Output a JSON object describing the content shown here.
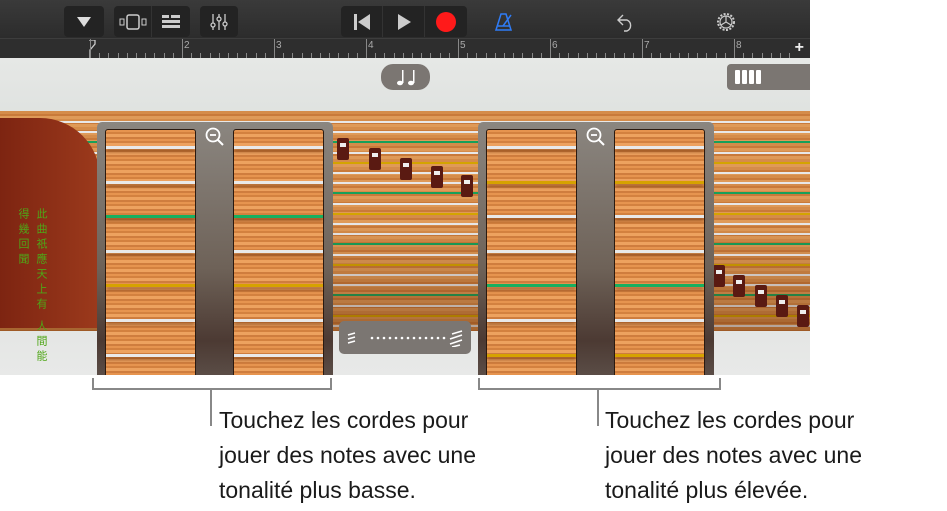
{
  "toolbar": {
    "icons": [
      "dropdown-icon",
      "view-toggle-icon",
      "tracks-view-icon",
      "mixer-icon",
      "rewind-icon",
      "play-icon",
      "record-icon",
      "metronome-icon",
      "undo-icon",
      "settings-icon"
    ],
    "colors": {
      "record": "#ff1a1a",
      "metronome": "#2f7cf6"
    }
  },
  "ruler": {
    "bars": [
      "2",
      "3",
      "4",
      "5",
      "6",
      "7",
      "8"
    ],
    "add_label": "+"
  },
  "instrument": {
    "inscription_right": "此曲祇應天上有",
    "inscription_left": "人間能得幾回聞",
    "string_colors": [
      "#e8e8e8",
      "#e8e8e8",
      "#16a05a",
      "#e8e8e8",
      "#d4a400",
      "#e8e8e8",
      "#e8e8e8",
      "#16a05a",
      "#e8e8e8",
      "#d4a400",
      "#e8e8e8",
      "#e8e8e8",
      "#16a05a",
      "#f4f4f4",
      "#d4a400",
      "#e8e8e8",
      "#e8e8e8",
      "#16a05a",
      "#e8e8e8",
      "#d4a400",
      "#e8e8e8"
    ],
    "low_panel_strings": [
      "#e9e9e9",
      "#e9e9e9",
      "#17b060",
      "#e9e9e9",
      "#d6a200",
      "#e9e9e9",
      "#e9e9e9",
      "#17b060"
    ],
    "high_panel_strings": [
      "#e9e9e9",
      "#d6a200",
      "#e9e9e9",
      "#e9e9e9",
      "#17b060",
      "#e9e9e9",
      "#d6a200",
      "#e9e9e9"
    ]
  },
  "callouts": {
    "low": [
      "Touchez les cordes pour",
      "jouer des notes avec une",
      "tonalité plus basse."
    ],
    "high": [
      "Touchez les cordes pour",
      "jouer des notes avec une",
      "tonalité plus élevée."
    ]
  }
}
